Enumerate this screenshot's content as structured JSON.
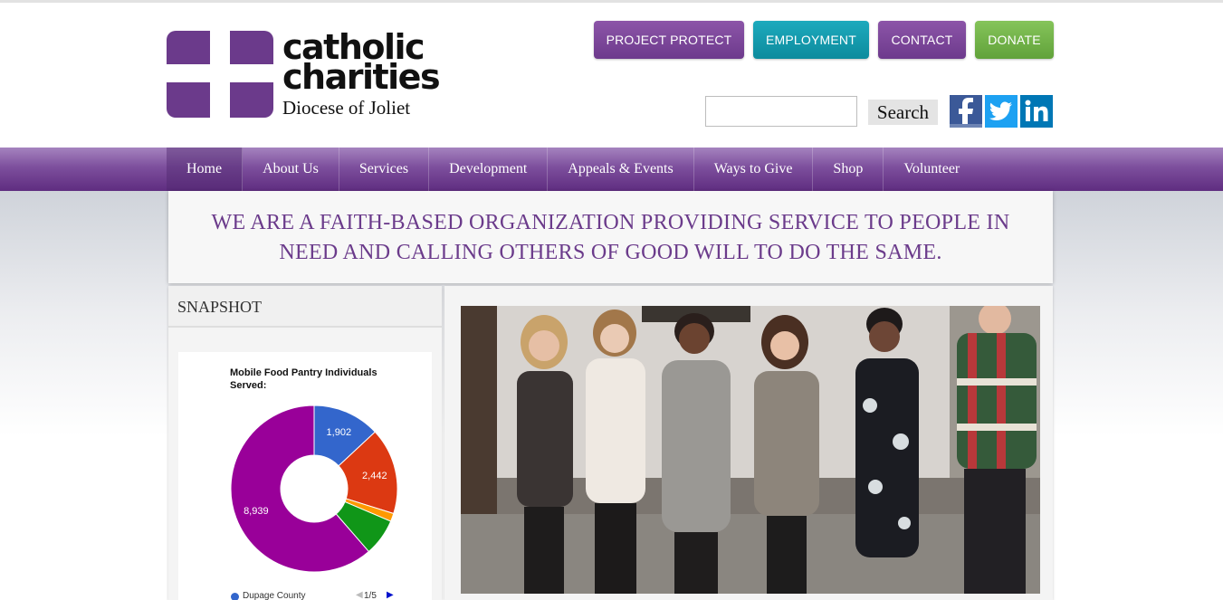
{
  "logo": {
    "line1": "catholic",
    "line2": "charities",
    "line3": "Diocese of Joliet"
  },
  "top_buttons": {
    "project_protect": "PROJECT PROTECT",
    "employment": "EMPLOYMENT",
    "contact": "CONTACT",
    "donate": "DONATE"
  },
  "colors": {
    "purple": "#7a4a99",
    "teal": "#1597a9",
    "green": "#6fb348",
    "nav_purple": "#6b3a8b"
  },
  "search": {
    "value": "",
    "placeholder": "",
    "button_label": "Search"
  },
  "social": [
    "facebook-icon",
    "twitter-icon",
    "linkedin-icon"
  ],
  "nav": {
    "items": [
      "Home",
      "About Us",
      "Services",
      "Development",
      "Appeals & Events",
      "Ways to Give",
      "Shop",
      "Volunteer"
    ],
    "active": "Home"
  },
  "mission": {
    "line1": "WE ARE A FAITH-BASED ORGANIZATION PROVIDING SERVICE TO PEOPLE IN",
    "line2": "NEED AND CALLING OTHERS OF GOOD WILL TO DO THE SAME."
  },
  "snapshot": {
    "title": "SNAPSHOT",
    "legend_first": "Dupage County",
    "legend_page": "1/5"
  },
  "chart_data": {
    "type": "pie",
    "title": "Mobile Food Pantry Individuals Served:",
    "donut": true,
    "values": [
      1902,
      2442,
      230,
      1050,
      8939
    ],
    "data_labels": [
      "1,902",
      "2,442",
      "",
      "",
      "8,939"
    ],
    "colors": [
      "#3366cc",
      "#dc3912",
      "#ff9900",
      "#109618",
      "#990099"
    ],
    "legend_position": "bottom"
  },
  "photo": {
    "description_icon": "group-photo-image"
  }
}
